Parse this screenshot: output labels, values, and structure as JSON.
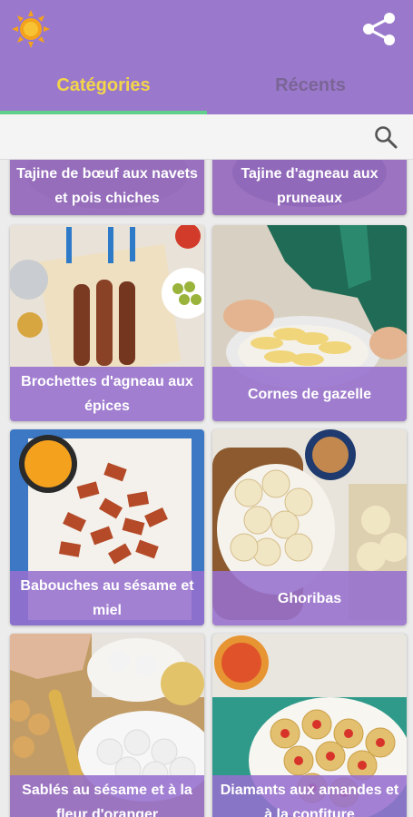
{
  "header": {
    "left_icon": "sun-icon",
    "right_icon": "share-icon"
  },
  "tabs": [
    {
      "label": "Catégories",
      "active": true
    },
    {
      "label": "Récents",
      "active": false
    }
  ],
  "search": {
    "icon": "search-icon"
  },
  "colors": {
    "primary": "#9a79cc",
    "active_tab": "#f3d54a",
    "inactive_tab": "#7a6596",
    "indicator": "#5fcf8a",
    "caption_bg": "#9670ce"
  },
  "recipes": [
    {
      "title": "Tajine de bœuf aux navets et pois chiches"
    },
    {
      "title": "Tajine d'agneau aux pruneaux"
    },
    {
      "title": "Brochettes d'agneau aux épices"
    },
    {
      "title": "Cornes de gazelle"
    },
    {
      "title": "Babouches au sésame et miel"
    },
    {
      "title": "Ghoribas"
    },
    {
      "title": "Sablés au sésame et à la fleur d'oranger"
    },
    {
      "title": "Diamants aux amandes et à la confiture"
    }
  ]
}
